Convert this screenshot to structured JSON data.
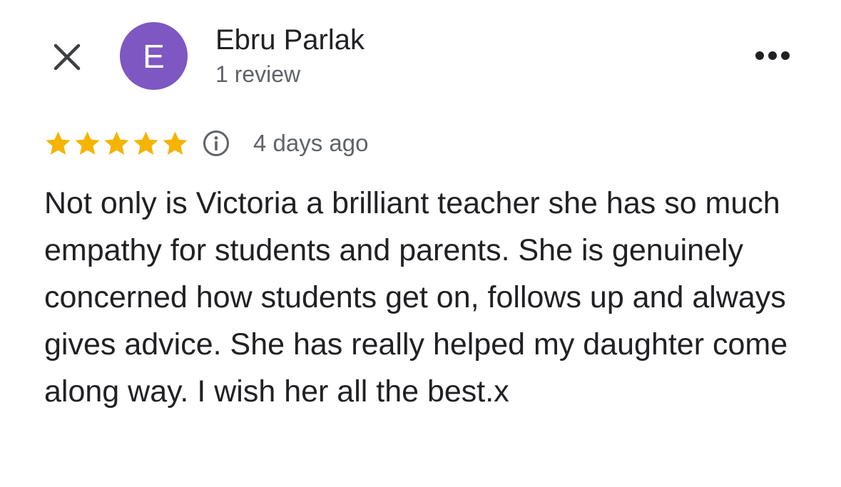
{
  "reviewer": {
    "initial": "E",
    "name": "Ebru Parlak",
    "review_count": "1 review",
    "avatar_color": "#7e57c2"
  },
  "header": {
    "close_icon": "close-icon",
    "more_icon": "more-horizontal-icon"
  },
  "review": {
    "rating": 5,
    "max_rating": 5,
    "star_color": "#f4b400",
    "time_ago": "4 days ago",
    "text": "Not only is Victoria a brilliant teacher she has so much empathy for students and parents. She is genuinely concerned how students get on, follows up and always gives advice. She has really helped my daughter come along way. I wish her all the best.x"
  }
}
